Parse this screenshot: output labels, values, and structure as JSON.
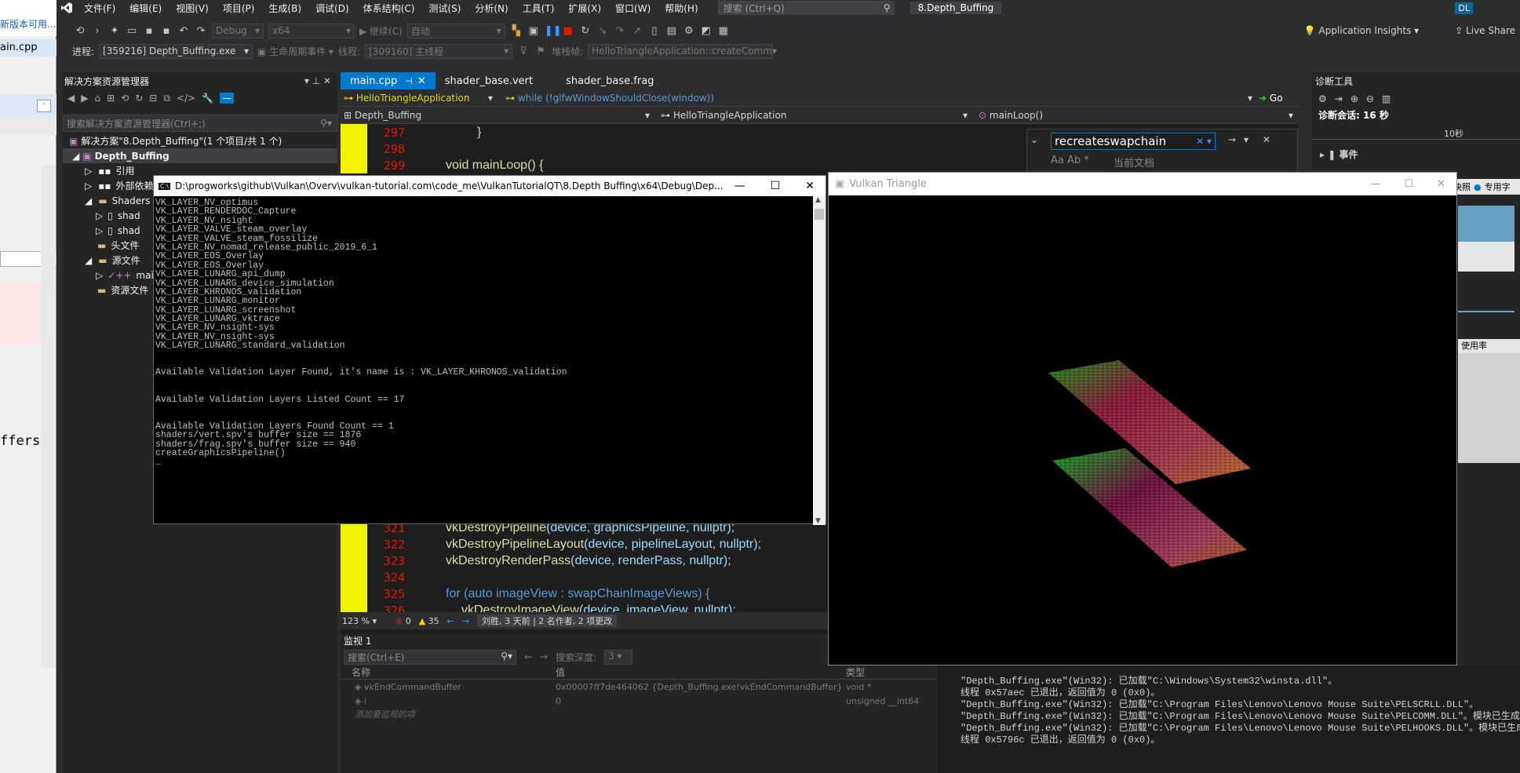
{
  "left_partial": {
    "banner": "新版本可用...",
    "tab_label": "ain.cpp",
    "code_fragment": "ffers"
  },
  "menubar": {
    "items": [
      "文件(F)",
      "编辑(E)",
      "视图(V)",
      "项目(P)",
      "生成(B)",
      "调试(D)",
      "体系结构(C)",
      "测试(S)",
      "分析(N)",
      "工具(T)",
      "扩展(X)",
      "窗口(W)",
      "帮助(H)"
    ],
    "search_placeholder": "搜索 (Ctrl+Q)",
    "solution_title": "8.Depth_Buffing",
    "user_initials": "DL"
  },
  "toolbar1": {
    "config": "Debug",
    "platform": "x64",
    "continue_label": "继续(C)",
    "auto_combo": "自动",
    "app_insights": "Application Insights",
    "live_share": "Live Share"
  },
  "toolbar2": {
    "process_label": "进程:",
    "process_value": "[359216] Depth_Buffing.exe",
    "lifecycle_label": "生命周期事件",
    "thread_label": "线程:",
    "thread_value": "[309160] 主线程",
    "stack_label": "堆栈帧:",
    "stack_value": "HelloTriangleApplication::createComm"
  },
  "solution_explorer": {
    "title": "解决方案资源管理器",
    "search_placeholder": "搜索解决方案资源管理器(Ctrl+;)",
    "items": [
      {
        "label": "解决方案\"8.Depth_Buffing\"(1 个项目/共 1 个)"
      },
      {
        "label": "Depth_Buffing"
      },
      {
        "label": "引用"
      },
      {
        "label": "外部依赖"
      },
      {
        "label": "Shaders"
      },
      {
        "label": "shad"
      },
      {
        "label": "shad"
      },
      {
        "label": "头文件"
      },
      {
        "label": "源文件"
      },
      {
        "label": "main"
      },
      {
        "label": "资源文件"
      }
    ]
  },
  "editor": {
    "tabs": [
      {
        "label": "main.cpp",
        "active": true
      },
      {
        "label": "shader_base.vert",
        "active": false
      },
      {
        "label": "shader_base.frag",
        "active": false
      }
    ],
    "nav_class": "HelloTriangleApplication",
    "nav_while": "while (!glfwWindowShouldClose(window))",
    "nav_go": "Go",
    "nav_project": "Depth_Buffing",
    "nav_scope": "HelloTriangleApplication",
    "nav_member": "mainLoop()",
    "top_lines": [
      {
        "num": "297",
        "text": "}"
      },
      {
        "num": "298",
        "text": ""
      },
      {
        "num": "299",
        "text": "void mainLoop() {"
      }
    ],
    "bottom_lines": [
      {
        "num": "321",
        "fn": "vkDestroyPipeline",
        "args": "(device, graphicsPipeline, nullptr);"
      },
      {
        "num": "322",
        "fn": "vkDestroyPipelineLayout",
        "args": "(device, pipelineLayout, nullptr);"
      },
      {
        "num": "323",
        "fn": "vkDestroyRenderPass",
        "args": "(device, renderPass, nullptr);"
      },
      {
        "num": "324",
        "fn": "",
        "args": ""
      },
      {
        "num": "325",
        "fn": "for (auto imageView : swapChainImageViews) {",
        "args": ""
      },
      {
        "num": "326",
        "fn": "vkDestroyImageView",
        "args": "(device, imageView, nullptr);"
      }
    ],
    "zoom": "123 %",
    "errors": "0",
    "warnings": "35",
    "codelens": "刘胜, 3 天前 | 2 名作者, 2 项更改"
  },
  "find_widget": {
    "query": "recreateswapchain",
    "scope": "当前文档"
  },
  "console": {
    "title": "D:\\progworks\\github\\Vulkan\\Overv\\vulkan-tutorial.com\\code_me\\VulkanTutorialQT\\8.Depth Buffing\\x64\\Debug\\Dep...",
    "lines": [
      "VK_LAYER_NV_optimus",
      "VK_LAYER_RENDERDOC_Capture",
      "VK_LAYER_NV_nsight",
      "VK_LAYER_VALVE_steam_overlay",
      "VK_LAYER_VALVE_steam_fossilize",
      "VK_LAYER_NV_nomad_release_public_2019_6_1",
      "VK_LAYER_EOS_Overlay",
      "VK_LAYER_EOS_Overlay",
      "VK_LAYER_LUNARG_api_dump",
      "VK_LAYER_LUNARG_device_simulation",
      "VK_LAYER_KHRONOS_validation",
      "VK_LAYER_LUNARG_monitor",
      "VK_LAYER_LUNARG_screenshot",
      "VK_LAYER_LUNARG_vktrace",
      "VK_LAYER_NV_nsight-sys",
      "VK_LAYER_NV_nsight-sys",
      "VK_LAYER_LUNARG_standard_validation",
      "",
      "",
      "Available Validation Layer Found, it's name is : VK_LAYER_KHRONOS_validation",
      "",
      "",
      "Available Validation Layers Listed Count == 17",
      "",
      "",
      "Available Validation Layers Found Count == 1",
      "shaders/vert.spv's buffer size == 1876",
      "shaders/frag.spv's buffer size == 940",
      "createGraphicsPipeline()",
      "_"
    ]
  },
  "vulkan_window": {
    "title": "Vulkan Triangle"
  },
  "watch": {
    "title": "监视 1",
    "search_placeholder": "搜索(Ctrl+E)",
    "depth_label": "搜索深度:",
    "depth_value": "3",
    "headers": [
      "名称",
      "值",
      "类型"
    ],
    "rows": [
      {
        "name": "vkEndCommandBuffer",
        "value": "0x00007ff7de464062 {Depth_Buffing.exe!vkEndCommandBuffer}",
        "type": "void *"
      },
      {
        "name": "i",
        "value": "0",
        "type": "unsigned __int64"
      }
    ],
    "add_item": "添加要监视的项"
  },
  "diagnostics": {
    "title": "诊断工具",
    "session": "诊断会话: 16 秒",
    "tick": "10秒",
    "events": "事件",
    "snapshot": "快照",
    "private_bytes": "专用字",
    "usage": "使用率"
  },
  "output": {
    "lines": [
      "\"Depth_Buffing.exe\"(Win32): 已加载\"C:\\Windows\\System32\\winsta.dll\"。",
      "线程 0x57aec 已退出，返回值为 0 (0x0)。",
      "\"Depth_Buffing.exe\"(Win32): 已加载\"C:\\Program Files\\Lenovo\\Lenovo Mouse Suite\\PELSCRLL.DLL\"。",
      "\"Depth_Buffing.exe\"(Win32): 已加载\"C:\\Program Files\\Lenovo\\Lenovo Mouse Suite\\PELCOMM.DLL\"。模块已生成，不包含符号。",
      "\"Depth_Buffing.exe\"(Win32): 已加载\"C:\\Program Files\\Lenovo\\Lenovo Mouse Suite\\PELHOOKS.DLL\"。模块已生成，不包含符号。",
      "线程 0x5796c 已退出，返回值为 0 (0x0)。"
    ]
  },
  "colors": {
    "accent": "#007acc",
    "breakpoint_gutter": "#f3f300",
    "line_number": "#e51400"
  }
}
